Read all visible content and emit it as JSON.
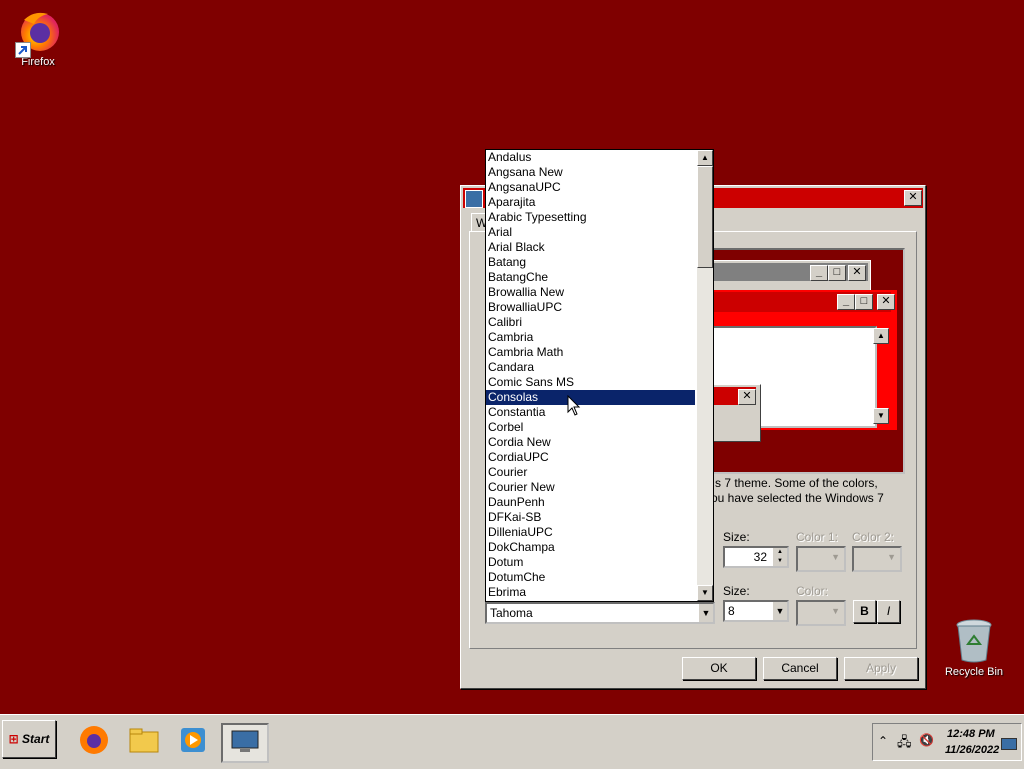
{
  "desktop": {
    "icons": [
      {
        "label": "Firefox"
      },
      {
        "label": "Recycle Bin"
      }
    ]
  },
  "dialog": {
    "tab_label": "W",
    "preview": {
      "scroll_up": "▲",
      "scroll_down": "▼"
    },
    "info_text_line1": "s 7 theme.  Some of the colors,",
    "info_text_line2": "ou have selected the Windows 7",
    "item_size_label": "Size:",
    "item_size_value": "32",
    "color1_label": "Color 1:",
    "color2_label": "Color 2:",
    "font_size_label": "Size:",
    "font_size_value": "8",
    "font_color_label": "Color:",
    "bold_label": "B",
    "italic_label": "I",
    "font_value": "Tahoma",
    "ok_label": "OK",
    "cancel_label": "Cancel",
    "apply_label": "Apply"
  },
  "font_list": {
    "selected": "Consolas",
    "items": [
      "Andalus",
      "Angsana New",
      "AngsanaUPC",
      "Aparajita",
      "Arabic Typesetting",
      "Arial",
      "Arial Black",
      "Batang",
      "BatangChe",
      "Browallia New",
      "BrowalliaUPC",
      "Calibri",
      "Cambria",
      "Cambria Math",
      "Candara",
      "Comic Sans MS",
      "Consolas",
      "Constantia",
      "Corbel",
      "Cordia New",
      "CordiaUPC",
      "Courier",
      "Courier New",
      "DaunPenh",
      "DFKai-SB",
      "DilleniaUPC",
      "DokChampa",
      "Dotum",
      "DotumChe",
      "Ebrima"
    ]
  },
  "taskbar": {
    "start_label": "Start",
    "clock_time": "12:48 PM",
    "clock_date": "11/26/2022"
  },
  "colors": {
    "desktop": "#7f0000",
    "title_active": "#cc0000",
    "selection": "#0a246a"
  }
}
